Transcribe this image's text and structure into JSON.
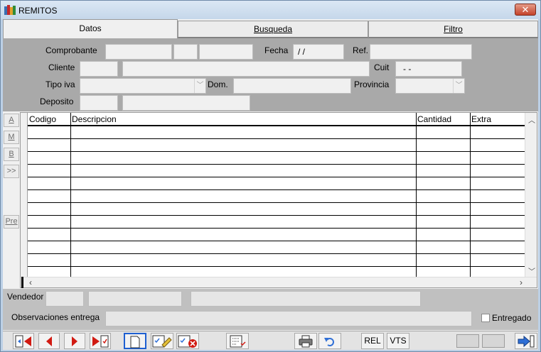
{
  "window": {
    "title": "REMITOS",
    "close_glyph": "✕"
  },
  "tabs": [
    {
      "label": "Datos",
      "active": true
    },
    {
      "label": "Busqueda",
      "active": false
    },
    {
      "label": "Filtro",
      "active": false
    }
  ],
  "form": {
    "comprobante_label": "Comprobante",
    "fecha_label": "Fecha",
    "fecha_value": " / /",
    "ref_label": "Ref.",
    "cliente_label": "Cliente",
    "cuit_label": "Cuit",
    "cuit_value": "-     -",
    "tipo_iva_label": "Tipo iva",
    "dom_label": "Dom.",
    "provincia_label": "Provincia",
    "deposito_label": "Deposito"
  },
  "side_buttons": [
    "A",
    "M",
    "B",
    ">>",
    "Pre"
  ],
  "grid": {
    "columns": [
      "Codigo",
      "Descripcion",
      "Cantidad",
      "Extra"
    ],
    "row_count": 12
  },
  "bottom": {
    "vendedor_label": "Vendedor",
    "observaciones_label": "Observaciones entrega",
    "entregado_label": "Entregado",
    "entregado_checked": false
  },
  "toolbar": {
    "rel_label": "REL",
    "vts_label": "VTS",
    "icons": [
      "first-record-icon",
      "prev-record-icon",
      "next-record-icon",
      "last-record-icon",
      "new-document-icon",
      "edit-icon",
      "delete-icon",
      "list-icon",
      "print-icon",
      "undo-icon",
      "exit-icon"
    ]
  },
  "colors": {
    "accent_red": "#d11a12",
    "accent_blue": "#2f6fd6"
  }
}
